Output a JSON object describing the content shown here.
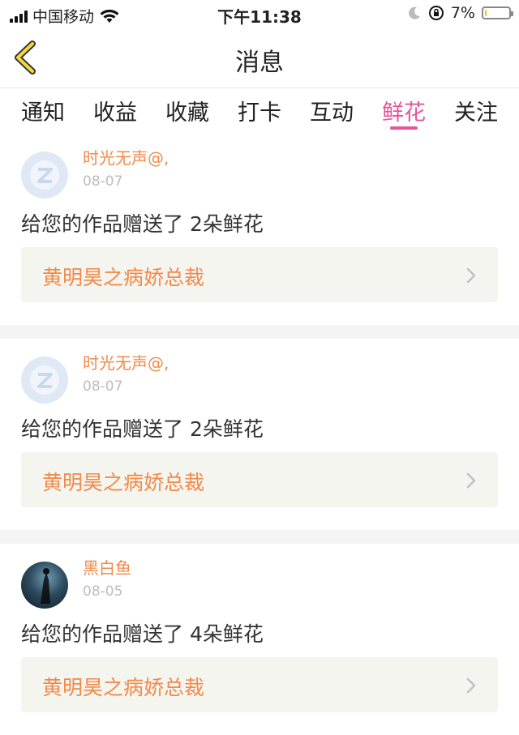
{
  "status_bar": {
    "carrier": "中国移动",
    "time": "下午11:38",
    "battery": "7%",
    "battery_level": 0.07,
    "icons": [
      "signal-icon",
      "wifi-icon",
      "moon-icon",
      "rotation-lock-icon",
      "battery-icon"
    ]
  },
  "header": {
    "title": "消息",
    "back_icon": "chevron-left-icon"
  },
  "tabs": [
    {
      "label": "通知"
    },
    {
      "label": "收益"
    },
    {
      "label": "收藏"
    },
    {
      "label": "打卡"
    },
    {
      "label": "互动"
    },
    {
      "label": "鲜花",
      "active": true
    },
    {
      "label": "关注"
    }
  ],
  "messages": [
    {
      "username": "时光无声@,",
      "date": "08-07",
      "text": "给您的作品赠送了 2朵鲜花",
      "work": "黄明昊之病娇总裁",
      "avatar": "default-q-avatar"
    },
    {
      "username": "时光无声@,",
      "date": "08-07",
      "text": "给您的作品赠送了 2朵鲜花",
      "work": "黄明昊之病娇总裁",
      "avatar": "default-q-avatar"
    },
    {
      "username": "黑白鱼",
      "date": "08-05",
      "text": "给您的作品赠送了 4朵鲜花",
      "work": "黄明昊之病娇总裁",
      "avatar": "photo-avatar"
    }
  ],
  "colors": {
    "accent": "#e6559a",
    "username": "#f08a4b",
    "date": "#bdbdbd"
  }
}
